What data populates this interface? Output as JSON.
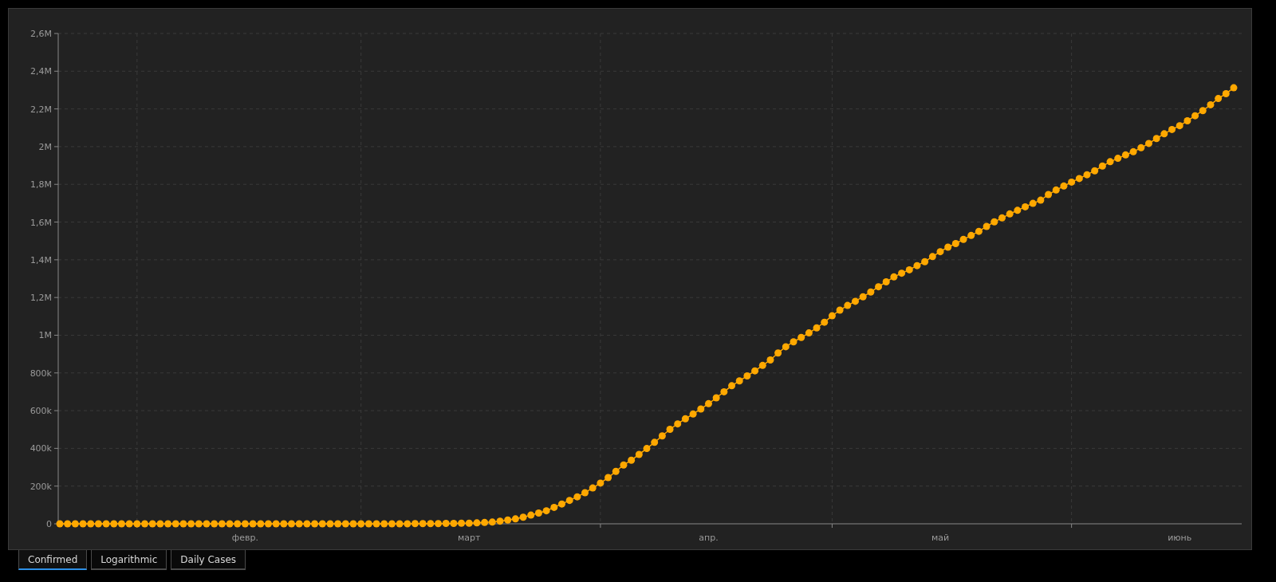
{
  "chart": {
    "chart_data": {
      "type": "line",
      "grid": true,
      "ylim": [
        0,
        2600000
      ],
      "categories": [
        null,
        null,
        null,
        null,
        null,
        null,
        null,
        null,
        null,
        null,
        null,
        null,
        null,
        null,
        null,
        null,
        null,
        null,
        null,
        null,
        null,
        null,
        null,
        null,
        "февр.",
        null,
        null,
        null,
        null,
        null,
        null,
        null,
        null,
        null,
        null,
        null,
        null,
        null,
        null,
        null,
        null,
        null,
        null,
        null,
        null,
        null,
        null,
        null,
        null,
        null,
        null,
        null,
        null,
        "март",
        null,
        null,
        null,
        null,
        null,
        null,
        null,
        null,
        null,
        null,
        null,
        null,
        null,
        null,
        null,
        null,
        null,
        null,
        null,
        null,
        null,
        null,
        null,
        null,
        null,
        null,
        null,
        null,
        null,
        null,
        "апр.",
        null,
        null,
        null,
        null,
        null,
        null,
        null,
        null,
        null,
        null,
        null,
        null,
        null,
        null,
        null,
        null,
        null,
        null,
        null,
        null,
        null,
        null,
        null,
        null,
        null,
        null,
        null,
        null,
        null,
        "май",
        null,
        null,
        null,
        null,
        null,
        null,
        null,
        null,
        null,
        null,
        null,
        null,
        null,
        null,
        null,
        null,
        null,
        null,
        null,
        null,
        null,
        null,
        null,
        null,
        null,
        null,
        null,
        null,
        null,
        null,
        "июнь",
        null,
        null,
        null,
        null,
        null,
        null,
        null
      ],
      "yticks": [
        {
          "value": 0,
          "label": "0"
        },
        {
          "value": 200000,
          "label": "200k"
        },
        {
          "value": 400000,
          "label": "400k"
        },
        {
          "value": 600000,
          "label": "600k"
        },
        {
          "value": 800000,
          "label": "800k"
        },
        {
          "value": 1000000,
          "label": "1M"
        },
        {
          "value": 1200000,
          "label": "1,2M"
        },
        {
          "value": 1400000,
          "label": "1,4M"
        },
        {
          "value": 1600000,
          "label": "1,6M"
        },
        {
          "value": 1800000,
          "label": "1,8M"
        },
        {
          "value": 2000000,
          "label": "2M"
        },
        {
          "value": 2200000,
          "label": "2,2M"
        },
        {
          "value": 2400000,
          "label": "2,4M"
        },
        {
          "value": 2600000,
          "label": "2,6M"
        }
      ],
      "series": [
        {
          "color": "#ffa800",
          "marker": "circle",
          "values": [
            0,
            0,
            0,
            0,
            0,
            0,
            0,
            0,
            0,
            0,
            0,
            0,
            0,
            0,
            0,
            0,
            0,
            0,
            0,
            0,
            0,
            0,
            0,
            0,
            0,
            0,
            0,
            0,
            0,
            0,
            0,
            0,
            0,
            0,
            0,
            0,
            0,
            0,
            0,
            0,
            0,
            0,
            0,
            0,
            0,
            0,
            1000,
            1000,
            1000,
            1000,
            2000,
            2000,
            3000,
            3000,
            5000,
            7000,
            9000,
            14000,
            20000,
            26000,
            35000,
            46000,
            57000,
            69000,
            87000,
            105000,
            124000,
            143000,
            165000,
            190000,
            216000,
            245000,
            278000,
            312000,
            337000,
            368000,
            399000,
            432000,
            466000,
            501000,
            530000,
            557000,
            582000,
            609000,
            637000,
            668000,
            700000,
            732000,
            758000,
            784000,
            811000,
            840000,
            869000,
            906000,
            939000,
            965000,
            988000,
            1012000,
            1039000,
            1069000,
            1103000,
            1133000,
            1158000,
            1180000,
            1204000,
            1229000,
            1257000,
            1283000,
            1309000,
            1329000,
            1347000,
            1369000,
            1390000,
            1417000,
            1443000,
            1467000,
            1486000,
            1508000,
            1529000,
            1551000,
            1577000,
            1601000,
            1622000,
            1643000,
            1662000,
            1681000,
            1699000,
            1716000,
            1746000,
            1770000,
            1791000,
            1812000,
            1831000,
            1851000,
            1872000,
            1897000,
            1920000,
            1938000,
            1956000,
            1973000,
            1994000,
            2017000,
            2043000,
            2068000,
            2091000,
            2111000,
            2137000,
            2164000,
            2191000,
            2222000,
            2255000,
            2281000,
            2312000
          ]
        }
      ]
    }
  },
  "tabs": [
    {
      "label": "Confirmed",
      "selected": true
    },
    {
      "label": "Logarithmic",
      "selected": false
    },
    {
      "label": "Daily Cases",
      "selected": false
    }
  ]
}
